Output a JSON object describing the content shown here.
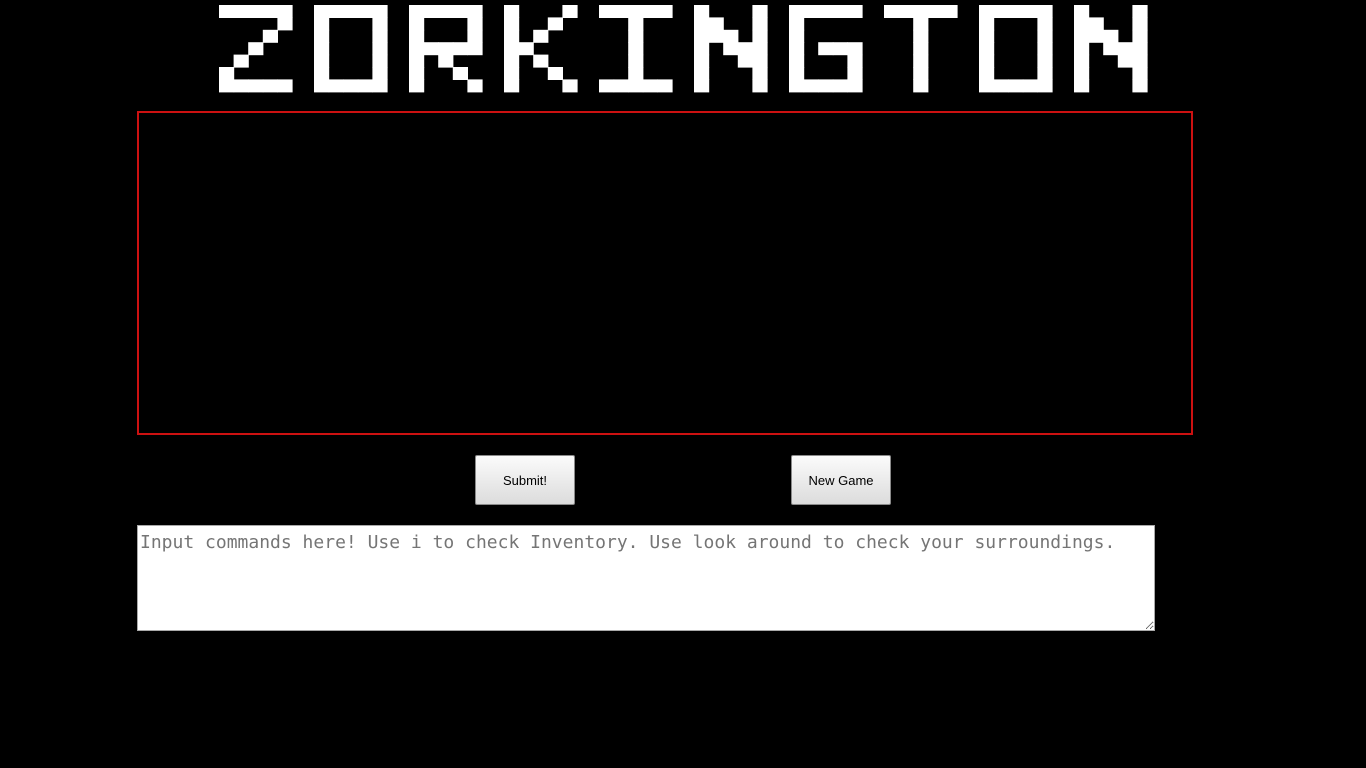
{
  "header": {
    "title": "ZORKINGTON"
  },
  "output": {
    "text": ""
  },
  "controls": {
    "submit_label": "Submit!",
    "new_game_label": "New Game"
  },
  "command": {
    "value": "",
    "placeholder": "Input commands here! Use i to check Inventory. Use look around to check your surroundings."
  },
  "colors": {
    "background": "#000000",
    "title": "#ffffff",
    "output_border": "#cc1111"
  }
}
